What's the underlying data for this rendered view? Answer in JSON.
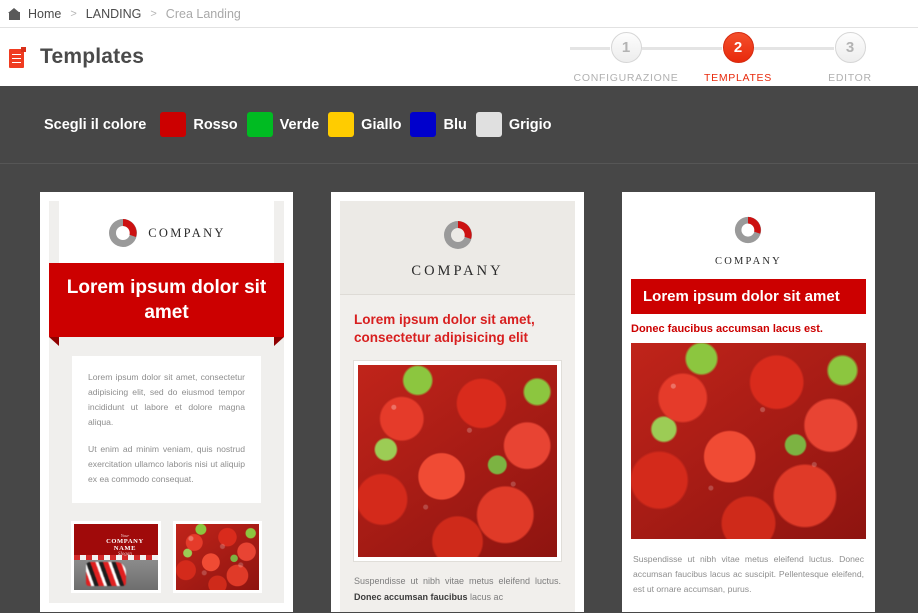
{
  "breadcrumb": {
    "home_icon": "home-icon",
    "items": [
      {
        "label": "Home",
        "active": false
      },
      {
        "label": "LANDING",
        "active": false
      },
      {
        "label": "Crea Landing",
        "active": true
      }
    ],
    "separator": ">"
  },
  "header": {
    "icon": "document-icon",
    "title": "Templates"
  },
  "stepper": {
    "steps": [
      {
        "number": "1",
        "label": "CONFIGURAZIONE",
        "state": "pending"
      },
      {
        "number": "2",
        "label": "TEMPLATES",
        "state": "current"
      },
      {
        "number": "3",
        "label": "EDITOR",
        "state": "pending"
      }
    ],
    "active_color": "#e8290b",
    "inactive_color": "#b0b0b0"
  },
  "color_picker": {
    "label": "Scegli il colore",
    "swatches": [
      {
        "name": "Rosso",
        "hex": "#cc0000"
      },
      {
        "name": "Verde",
        "hex": "#00bb22"
      },
      {
        "name": "Giallo",
        "hex": "#ffcc00"
      },
      {
        "name": "Blu",
        "hex": "#0000cc"
      },
      {
        "name": "Grigio",
        "hex": "#e0e0e0"
      }
    ]
  },
  "templates": [
    {
      "id": "template-1",
      "logo_text": "COMPANY",
      "banner_title": "Lorem ipsum dolor sit amet",
      "banner_color": "#cc0000",
      "paragraphs": [
        "Lorem ipsum dolor sit amet, consectetur adipisicing elit, sed do eiusmod tempor incididunt ut labore et dolore magna aliqua.",
        "Ut enim ad minim veniam, quis nostrud exercitation ullamco laboris nisi ut aliquip ex ea commodo consequat."
      ],
      "thumb_caption_line1": "Your",
      "thumb_caption_line2": "COMPANY NAME",
      "thumb_caption_line3": "Slogan"
    },
    {
      "id": "template-2",
      "logo_text": "COMPANY",
      "title": "Lorem ipsum dolor sit amet, consectetur adipisicing elit",
      "title_color": "#d81f1f",
      "body_prefix": "Suspendisse ut nibh vitae metus eleifend luctus. ",
      "body_bold": "Donec accumsan faucibus",
      "body_suffix": " lacus ac"
    },
    {
      "id": "template-3",
      "logo_text": "COMPANY",
      "banner_title": "Lorem ipsum dolor sit amet",
      "banner_color": "#cc0000",
      "subtitle": "Donec faucibus accumsan lacus est.",
      "body": "Suspendisse ut nibh vitae metus eleifend luctus. Donec accumsan faucibus lacus ac suscipit. Pellentesque eleifend, est ut ornare accumsan, purus."
    }
  ]
}
